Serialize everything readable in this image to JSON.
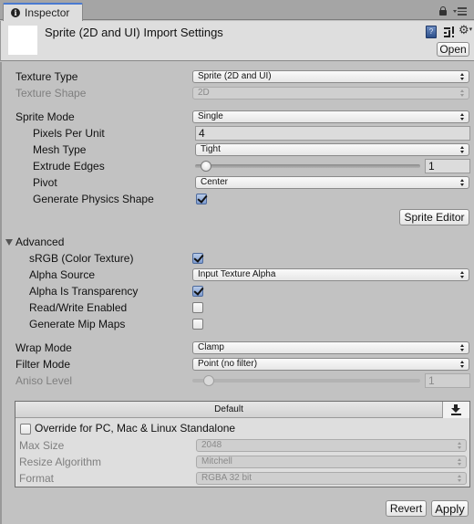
{
  "window": {
    "tab_label": "Inspector",
    "tab_icon": "info-icon",
    "lock_icon": "lock-icon",
    "menu_icon": "context-menu-icon"
  },
  "header": {
    "title": "Sprite (2D and UI) Import Settings",
    "open_label": "Open",
    "help_glyph": "?",
    "icons": [
      "help-book-icon",
      "preset-sliders-icon",
      "gear-icon"
    ]
  },
  "fields": {
    "texture_type": {
      "label": "Texture Type",
      "value": "Sprite (2D and UI)"
    },
    "texture_shape": {
      "label": "Texture Shape",
      "value": "2D",
      "disabled": true
    },
    "sprite_mode": {
      "label": "Sprite Mode",
      "value": "Single"
    },
    "pixels_per_unit": {
      "label": "Pixels Per Unit",
      "value": "4"
    },
    "mesh_type": {
      "label": "Mesh Type",
      "value": "Tight"
    },
    "extrude_edges": {
      "label": "Extrude Edges",
      "value": "1",
      "range": [
        0,
        32
      ]
    },
    "pivot": {
      "label": "Pivot",
      "value": "Center"
    },
    "generate_physics_shape": {
      "label": "Generate Physics Shape",
      "checked": true
    },
    "sprite_editor_label": "Sprite Editor"
  },
  "advanced": {
    "label": "Advanced",
    "expanded": true,
    "srgb": {
      "label": "sRGB (Color Texture)",
      "checked": true
    },
    "alpha_source": {
      "label": "Alpha Source",
      "value": "Input Texture Alpha"
    },
    "alpha_is_transparency": {
      "label": "Alpha Is Transparency",
      "checked": true
    },
    "read_write": {
      "label": "Read/Write Enabled",
      "checked": false
    },
    "generate_mip_maps": {
      "label": "Generate Mip Maps",
      "checked": false
    }
  },
  "sampling": {
    "wrap_mode": {
      "label": "Wrap Mode",
      "value": "Clamp"
    },
    "filter_mode": {
      "label": "Filter Mode",
      "value": "Point (no filter)"
    },
    "aniso_level": {
      "label": "Aniso Level",
      "value": "1",
      "range": [
        0,
        16
      ],
      "disabled": true
    }
  },
  "platform": {
    "tabs": [
      {
        "label": "Default",
        "selected": false
      },
      {
        "label": "",
        "icon": "download-standalone-icon",
        "selected": true
      }
    ],
    "override": {
      "label": "Override for PC, Mac & Linux Standalone",
      "checked": false
    },
    "max_size": {
      "label": "Max Size",
      "value": "2048"
    },
    "resize_algorithm": {
      "label": "Resize Algorithm",
      "value": "Mitchell"
    },
    "format": {
      "label": "Format",
      "value": "RGBA 32 bit"
    }
  },
  "footer": {
    "revert_label": "Revert",
    "apply_label": "Apply"
  }
}
